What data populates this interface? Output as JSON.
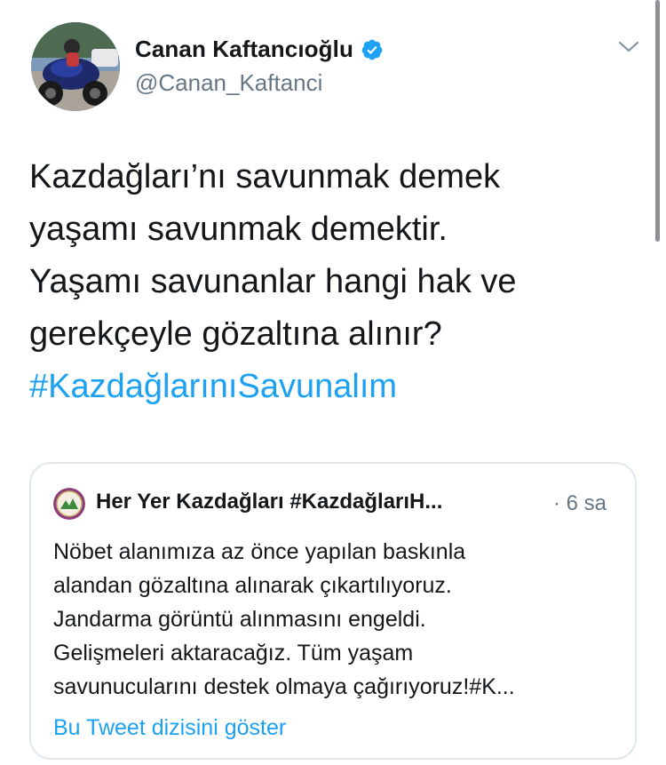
{
  "tweet": {
    "author": {
      "display_name": "Canan Kaftancıoğlu",
      "handle": "@Canan_Kaftanci",
      "verified": true,
      "avatar_icon": "avatar-motorcycle-photo"
    },
    "menu_icon": "chevron-down-icon",
    "text_lines": [
      "Kazdağları’nı savunmak demek",
      "yaşamı savunmak demektir.",
      "Yaşamı savunanlar hangi hak ve",
      "gerekçeyle gözaltına alınır?"
    ],
    "hashtag": "#KazdağlarınıSavunalım"
  },
  "quoted_tweet": {
    "author_name": "Her Yer Kazdağları #KazdağlarıH...",
    "time": "· 6 sa",
    "avatar_icon": "organization-logo-icon",
    "text_lines": [
      "Nöbet alanımıza az önce yapılan baskınla",
      "alandan gözaltına alınarak çıkartılıyoruz.",
      "Jandarma görüntü alınmasını engeldi.",
      "Gelişmeleri aktaracağız. Tüm yaşam",
      "savunucularını destek olmaya çağırıyoruz!#K..."
    ],
    "show_thread_label": "Bu Tweet dizisini göster"
  },
  "colors": {
    "link": "#1da1f2",
    "text": "#14171a",
    "secondary_text": "#657786",
    "border": "#e1e8ed",
    "verified": "#1da1f2"
  }
}
